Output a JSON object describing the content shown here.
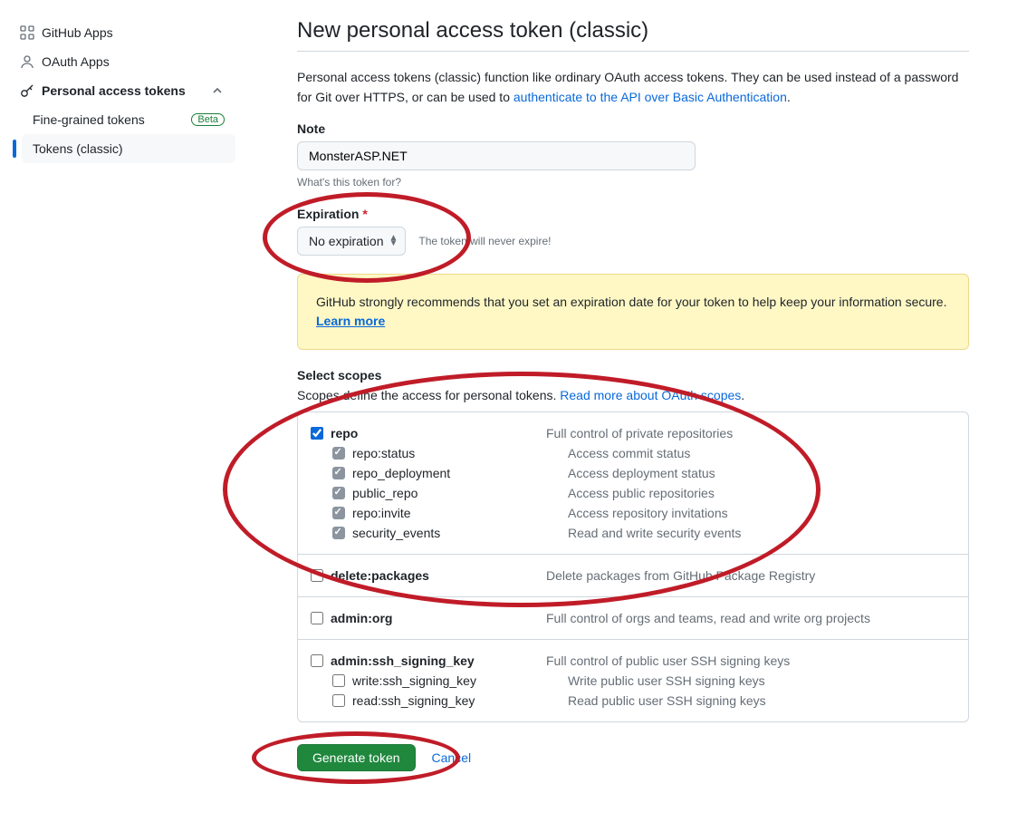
{
  "sidebar": {
    "items": [
      {
        "label": "GitHub Apps"
      },
      {
        "label": "OAuth Apps"
      },
      {
        "label": "Personal access tokens"
      }
    ],
    "sub": {
      "fine": "Fine-grained tokens",
      "beta": "Beta",
      "classic": "Tokens (classic)"
    }
  },
  "page": {
    "title": "New personal access token (classic)",
    "intro_a": "Personal access tokens (classic) function like ordinary OAuth access tokens. They can be used instead of a password for Git over HTTPS, or can be used to ",
    "intro_link": "authenticate to the API over Basic Authentication",
    "note_label": "Note",
    "note_value": "MonsterASP.NET",
    "note_hint": "What's this token for?",
    "exp_label": "Expiration",
    "exp_value": "No expiration",
    "exp_note": "The token will never expire!",
    "flash_text": "GitHub strongly recommends that you set an expiration date for your token to help keep your information secure.",
    "flash_link": "Learn more",
    "scopes_title": "Select scopes",
    "scopes_intro": "Scopes define the access for personal tokens. ",
    "scopes_link": "Read more about OAuth scopes",
    "generate": "Generate token",
    "cancel": "Cancel",
    "dot": "."
  },
  "scopes": {
    "repo": {
      "name": "repo",
      "desc": "Full control of private repositories",
      "children": [
        {
          "name": "repo:status",
          "desc": "Access commit status"
        },
        {
          "name": "repo_deployment",
          "desc": "Access deployment status"
        },
        {
          "name": "public_repo",
          "desc": "Access public repositories"
        },
        {
          "name": "repo:invite",
          "desc": "Access repository invitations"
        },
        {
          "name": "security_events",
          "desc": "Read and write security events"
        }
      ]
    },
    "deletepkg": {
      "name": "delete:packages",
      "desc": "Delete packages from GitHub Package Registry"
    },
    "adminorg": {
      "name": "admin:org",
      "desc": "Full control of orgs and teams, read and write org projects"
    },
    "sshkey": {
      "name": "admin:ssh_signing_key",
      "desc": "Full control of public user SSH signing keys",
      "children": [
        {
          "name": "write:ssh_signing_key",
          "desc": "Write public user SSH signing keys"
        },
        {
          "name": "read:ssh_signing_key",
          "desc": "Read public user SSH signing keys"
        }
      ]
    }
  }
}
